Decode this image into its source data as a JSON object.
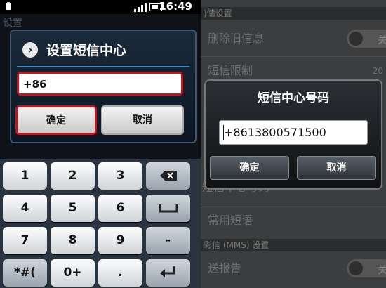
{
  "left_screen": {
    "status": {
      "time": "16:49"
    },
    "background_title": "设置",
    "dialog": {
      "title": "设置短信中心",
      "input_value": "+86",
      "ok_label": "确定",
      "cancel_label": "取消"
    },
    "keypad": {
      "keys": [
        "1",
        "2",
        "3",
        "⌫",
        "4",
        "5",
        "6",
        "␣",
        "7",
        "8",
        "9",
        "-",
        "*#(",
        "0+",
        ".",
        "↵"
      ]
    }
  },
  "right_screen": {
    "background": {
      "top_header": ")储设置",
      "row_delete_old": "删除旧信息",
      "row_limit": "短信限制",
      "limit_value": "20",
      "row_center_number": "短信中心号码",
      "row_common_phrases": "常用短语",
      "mms_header": "彩信 (MMS) 设置",
      "row_delivery_report": "送报告",
      "toggle_off": "关"
    },
    "dialog": {
      "title": "短信中心号码",
      "input_value": "+8613800571500",
      "ok_label": "确定",
      "cancel_label": "取消"
    }
  },
  "colors": {
    "highlight_red": "#c4141b",
    "accent_blue": "#3b86c6"
  }
}
